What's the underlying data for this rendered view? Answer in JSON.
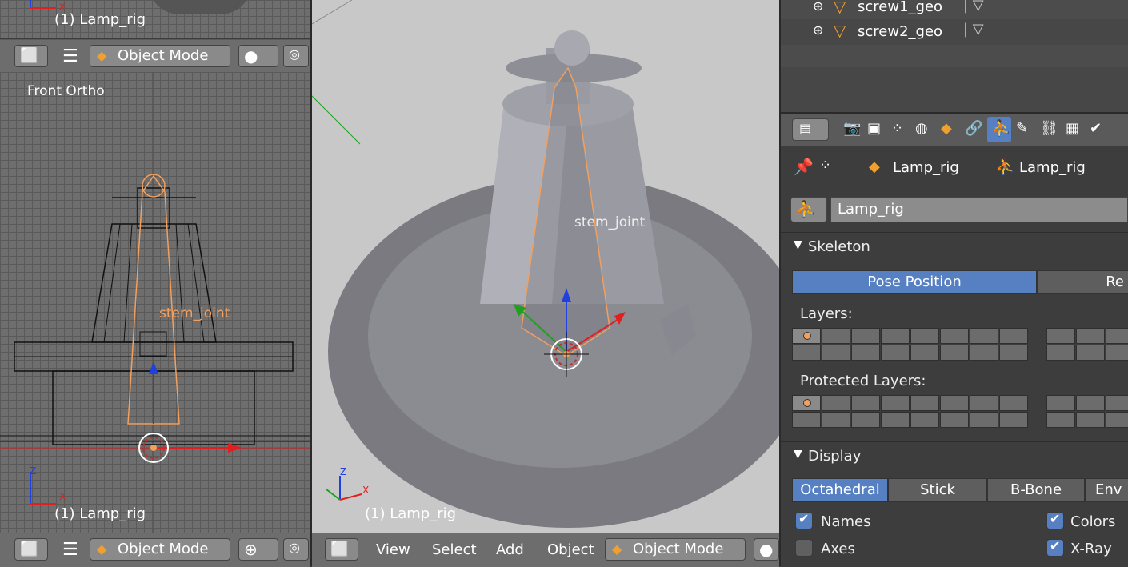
{
  "top_left_view": {
    "label": "(1) Lamp_rig"
  },
  "header_top_left": {
    "mode": "Object Mode"
  },
  "front_view": {
    "title": "Front Ortho",
    "bone_label": "stem_joint",
    "bottom_label": "(1) Lamp_rig",
    "axis_z": "Z",
    "axis_x": "X"
  },
  "header_bottom_left": {
    "mode": "Object Mode"
  },
  "persp_view": {
    "bone_label": "stem_joint",
    "bottom_label": "(1) Lamp_rig",
    "axis_z": "Z",
    "axis_x": "X"
  },
  "header_bottom_center": {
    "menus": [
      "View",
      "Select",
      "Add",
      "Object"
    ],
    "mode": "Object Mode"
  },
  "outliner": {
    "items": [
      {
        "name": "screw1_geo"
      },
      {
        "name": "screw2_geo"
      }
    ]
  },
  "properties": {
    "breadcrumb": [
      "Lamp_rig",
      "Lamp_rig"
    ],
    "datablock_name": "Lamp_rig",
    "skeleton": {
      "title": "Skeleton",
      "pose_position": "Pose Position",
      "rest_position_partial": "Re",
      "layers_label": "Layers:",
      "protected_layers_label": "Protected Layers:"
    },
    "display": {
      "title": "Display",
      "modes": [
        "Octahedral",
        "Stick",
        "B-Bone",
        "Env"
      ],
      "active_mode": "Octahedral",
      "options": [
        {
          "label": "Names",
          "checked": true
        },
        {
          "label": "Colors",
          "checked": true
        },
        {
          "label": "Axes",
          "checked": false
        },
        {
          "label": "X-Ray",
          "checked": true
        }
      ]
    }
  },
  "colors": {
    "accent": "#5680c2",
    "bone_orange": "#f0a060",
    "axis_red": "#e02020",
    "axis_green": "#20b020",
    "axis_blue": "#2040e0"
  }
}
